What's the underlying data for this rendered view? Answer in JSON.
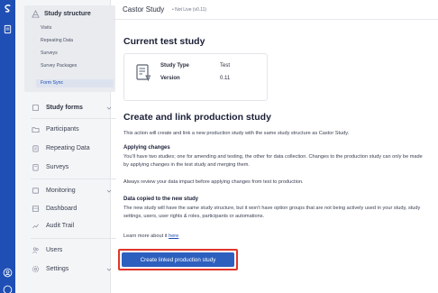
{
  "app": {
    "title": "Castor Study",
    "badge": "• Not Live (v0.11)"
  },
  "sidebar": {
    "study_structure": {
      "label": "Study structure",
      "items": [
        "Visits",
        "Repeating Data",
        "Surveys",
        "Survey Packages",
        "Form Sync"
      ]
    },
    "items": {
      "study_forms": "Study forms",
      "participants": "Participants",
      "repeating_data": "Repeating Data",
      "surveys": "Surveys",
      "monitoring": "Monitoring",
      "dashboard": "Dashboard",
      "audit_trail": "Audit Trail",
      "users": "Users",
      "settings": "Settings"
    }
  },
  "main": {
    "heading": "Current test study",
    "card": {
      "type_label": "Study Type",
      "type_value": "Test",
      "version_label": "Version",
      "version_value": "0.11"
    },
    "section_heading": "Create and link production study",
    "intro": "This action will create and link a new production study with the same study structure as Castor Study.",
    "applying_heading": "Applying changes",
    "applying_text": "You'll have two studies; one for amending and testing, the other for data collection. Changes to the production study can only be made by applying changes in the test study and merging them.",
    "review_text": "Always review your data impact before applying changes from test to production.",
    "copied_heading": "Data copied to the new study",
    "copied_text": "The new study will have the same study structure, but it won't have option groups that are not being actively used in your study, study settings, users, user rights & roles, participants or automations.",
    "learn_prefix": "Learn more about it",
    "learn_link": "here",
    "button_label": "Create linked production study"
  }
}
